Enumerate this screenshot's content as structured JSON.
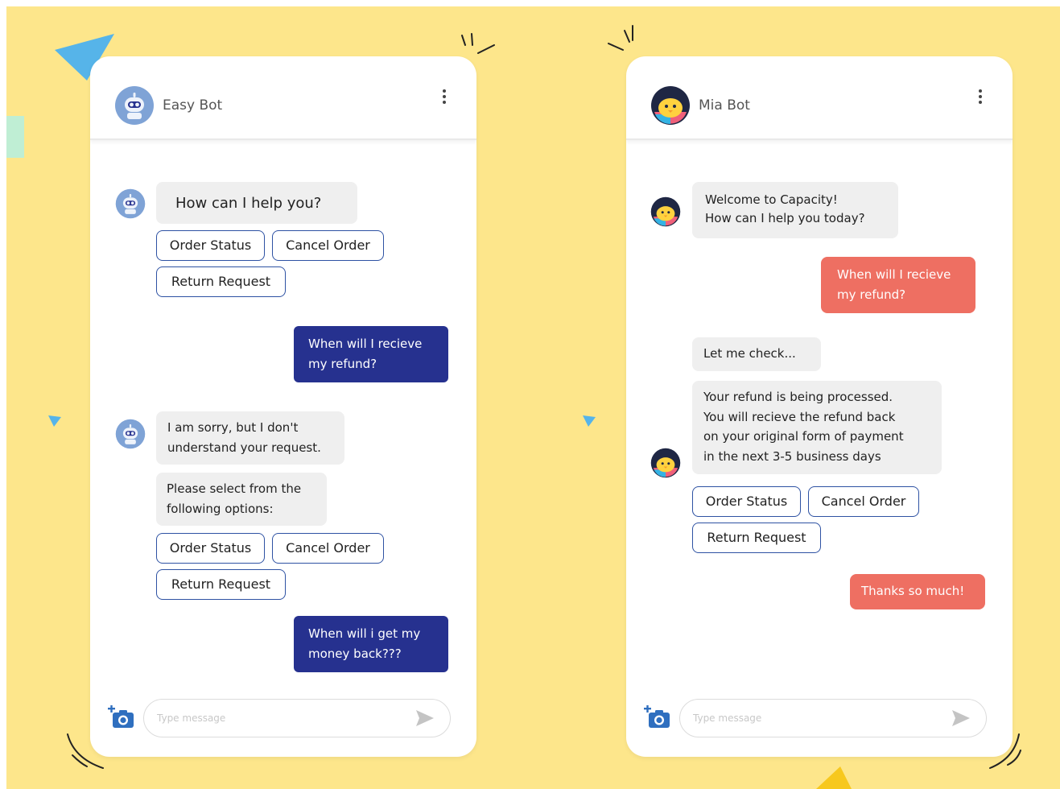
{
  "colors": {
    "background": "#fde68b",
    "panel": "#ffffff",
    "bot_bubble": "#efefef",
    "user_bubble_easy": "#26318f",
    "user_bubble_mia": "#ee6f62",
    "chip_border": "#2e52a3",
    "accent_blue": "#4aa8df"
  },
  "easy_bot": {
    "name": "Easy Bot",
    "avatar_icon": "robot-icon",
    "menu_icon": "vertical-ellipsis-icon",
    "messages": {
      "greeting": "How can I help you?",
      "chips_1": [
        "Order Status",
        "Cancel Order",
        "Return Request"
      ],
      "user_1": "When will I recieve\nmy refund?",
      "bot_error": "I am sorry, but I don't\nunderstand your request.",
      "bot_prompt": "Please select from the\nfollowing options:",
      "chips_2": [
        "Order Status",
        "Cancel Order",
        "Return Request"
      ],
      "user_2": "When will i get my\nmoney back???"
    },
    "composer": {
      "placeholder": "Type message",
      "camera_icon": "add-camera-icon",
      "send_icon": "send-icon"
    }
  },
  "mia_bot": {
    "name": "Mia Bot",
    "avatar_icon": "chick-mascot-icon",
    "menu_icon": "vertical-ellipsis-icon",
    "messages": {
      "welcome": "Welcome to Capacity!\nHow can I help you today?",
      "user_1": "When will I recieve\nmy refund?",
      "bot_check": "Let me check...",
      "bot_answer": "Your refund is being processed.\nYou will recieve the refund back\non your original form of payment\nin the next 3-5 business days",
      "chips": [
        "Order Status",
        "Cancel Order",
        "Return Request"
      ],
      "user_2": "Thanks so much!"
    },
    "composer": {
      "placeholder": "Type message",
      "camera_icon": "add-camera-icon",
      "send_icon": "send-icon"
    }
  }
}
